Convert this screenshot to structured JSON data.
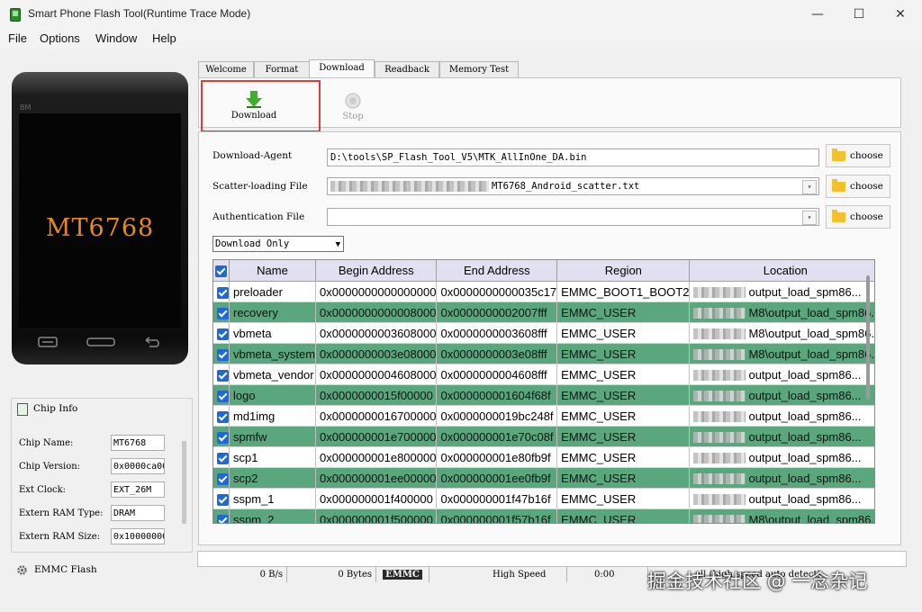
{
  "window": {
    "title": "Smart Phone Flash Tool(Runtime Trace Mode)",
    "minimize": "—",
    "maximize": "☐",
    "close": "✕"
  },
  "menu": [
    "File",
    "Options",
    "Window",
    "Help"
  ],
  "phone": {
    "chip": "MT6768",
    "brand": "BM"
  },
  "chip_info": {
    "title": "Chip Info",
    "rows": [
      {
        "label": "Chip Name:",
        "value": "MT6768"
      },
      {
        "label": "Chip Version:",
        "value": "0x0000ca00"
      },
      {
        "label": "Ext Clock:",
        "value": "EXT_26M"
      },
      {
        "label": "Extern RAM Type:",
        "value": "DRAM"
      },
      {
        "label": "Extern RAM Size:",
        "value": "0x100000000"
      }
    ],
    "flash_label": "EMMC Flash"
  },
  "tabs": [
    "Welcome",
    "Format",
    "Download",
    "Readback",
    "Memory Test"
  ],
  "toolbar": {
    "download_label": "Download",
    "stop_label": "Stop"
  },
  "fields": {
    "da_label": "Download-Agent",
    "da_value": "D:\\tools\\SP_Flash_Tool_V5\\MTK_AllInOne_DA.bin",
    "scatter_label": "Scatter-loading File",
    "scatter_value": "MT6768_Android_scatter.txt",
    "auth_label": "Authentication File",
    "auth_value": "",
    "choose": "choose"
  },
  "mode": "Download Only",
  "table": {
    "headers": [
      "Name",
      "Begin Address",
      "End Address",
      "Region",
      "Location"
    ],
    "rows": [
      {
        "name": "preloader",
        "begin": "0x0000000000000000",
        "end": "0x0000000000035c17",
        "region": "EMMC_BOOT1_BOOT2",
        "loc": "output_load_spm86..."
      },
      {
        "name": "recovery",
        "begin": "0x0000000000008000",
        "end": "0x0000000002007fff",
        "region": "EMMC_USER",
        "loc": "M8\\output_load_spm86..."
      },
      {
        "name": "vbmeta",
        "begin": "0x0000000003608000",
        "end": "0x0000000003608fff",
        "region": "EMMC_USER",
        "loc": "M8\\output_load_spm86..."
      },
      {
        "name": "vbmeta_system",
        "begin": "0x0000000003e08000",
        "end": "0x0000000003e08fff",
        "region": "EMMC_USER",
        "loc": "M8\\output_load_spm86..."
      },
      {
        "name": "vbmeta_vendor",
        "begin": "0x0000000004608000",
        "end": "0x0000000004608fff",
        "region": "EMMC_USER",
        "loc": "output_load_spm86..."
      },
      {
        "name": "logo",
        "begin": "0x0000000015f00000",
        "end": "0x000000001604f68f",
        "region": "EMMC_USER",
        "loc": "output_load_spm86..."
      },
      {
        "name": "md1img",
        "begin": "0x0000000016700000",
        "end": "0x0000000019bc248f",
        "region": "EMMC_USER",
        "loc": "output_load_spm86..."
      },
      {
        "name": "spmfw",
        "begin": "0x000000001e700000",
        "end": "0x000000001e70c08f",
        "region": "EMMC_USER",
        "loc": "output_load_spm86..."
      },
      {
        "name": "scp1",
        "begin": "0x000000001e800000",
        "end": "0x000000001e80fb9f",
        "region": "EMMC_USER",
        "loc": "output_load_spm86..."
      },
      {
        "name": "scp2",
        "begin": "0x000000001ee00000",
        "end": "0x000000001ee0fb9f",
        "region": "EMMC_USER",
        "loc": "output_load_spm86..."
      },
      {
        "name": "sspm_1",
        "begin": "0x000000001f400000",
        "end": "0x000000001f47b16f",
        "region": "EMMC_USER",
        "loc": "output_load_spm86..."
      },
      {
        "name": "sspm_2",
        "begin": "0x000000001f500000",
        "end": "0x000000001f57b16f",
        "region": "EMMC_USER",
        "loc": "M8\\output_load_spm86..."
      }
    ]
  },
  "status": {
    "speed": "0 B/s",
    "bytes": "0 Bytes",
    "storage": "EMMC",
    "mode": "High Speed",
    "time": "0:00",
    "extra": "all (high speed auto detect)"
  },
  "watermark": "掘金技术社区 @ 一念杂记",
  "colors": {
    "row_green": "#5aa77e",
    "header": "#e0e0f0",
    "highlight": "#e23a3a",
    "chip_text": "#e88a1a"
  }
}
